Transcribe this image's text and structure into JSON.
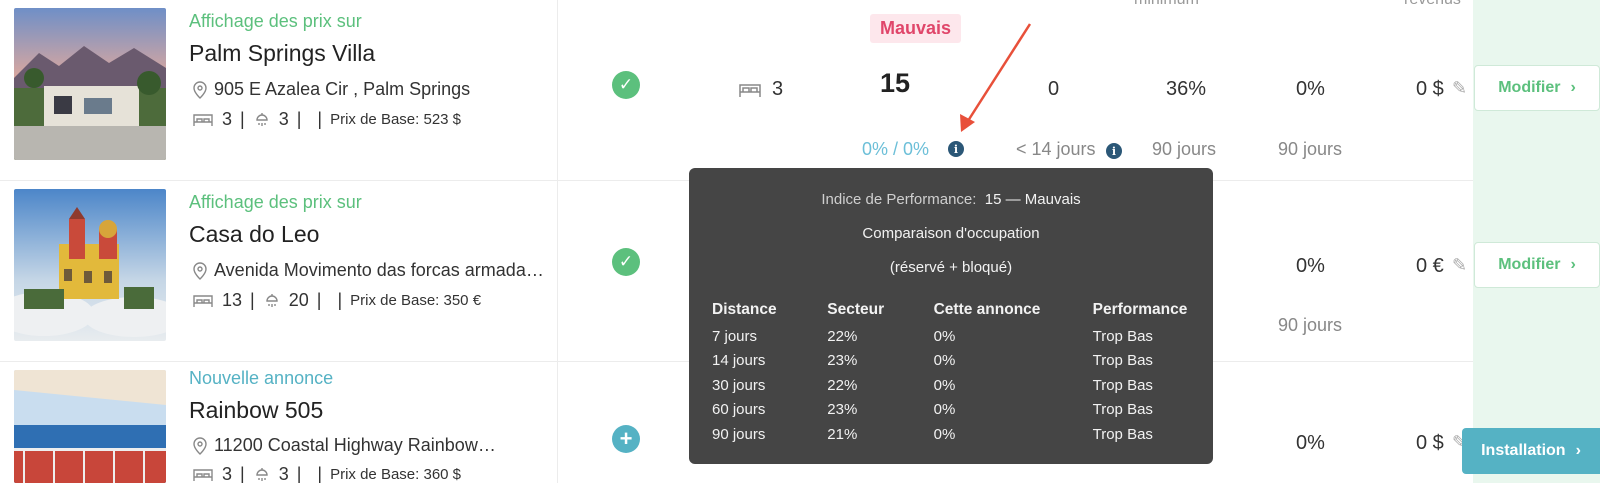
{
  "columns": {
    "minimum_label": "minimum",
    "revenus_label": "revenus"
  },
  "rows": [
    {
      "status": "Affichage des prix sur",
      "name": "Palm Springs Villa",
      "address": "905 E Azalea Cir , Palm Springs",
      "bedrooms": "3",
      "bathrooms": "3",
      "base_price": "Prix de Base: 523 $",
      "beds": "3",
      "perf_badge": "Mauvais",
      "perf_score": "15",
      "occupancy": "0% / 0%",
      "pickup": "0",
      "pickup_sub": "< 14 jours",
      "min_stay": "36%",
      "min_sub": "90 jours",
      "revenue_pct": "0%",
      "rev_sub": "90 jours",
      "revenue": "0 $",
      "modify": "Modifier"
    },
    {
      "status": "Affichage des prix sur",
      "name": "Casa do Leo",
      "address": "Avenida Movimento das forcas armada…",
      "bedrooms": "13",
      "bathrooms": "20",
      "base_price": "Prix de Base: 350 €",
      "revenue_pct": "0%",
      "rev_sub": "90 jours",
      "min_sub_partial": "s",
      "revenue": "0 €",
      "modify": "Modifier"
    },
    {
      "status": "Nouvelle annonce",
      "name": "Rainbow 505",
      "address": "11200 Coastal Highway Rainbow…",
      "bedrooms": "3",
      "bathrooms": "3",
      "base_price": "Prix de Base: 360 $",
      "revenue_pct": "0%",
      "revenue": "0 $"
    }
  ],
  "tooltip": {
    "perf_label": "Indice de Performance:",
    "perf_value": "15 — Mauvais",
    "title": "Comparaison d'occupation",
    "subtitle": "(réservé + bloqué)",
    "headers": [
      "Distance",
      "Secteur",
      "Cette annonce",
      "Performance"
    ],
    "rows": [
      [
        "7 jours",
        "22%",
        "0%",
        "Trop Bas"
      ],
      [
        "14 jours",
        "23%",
        "0%",
        "Trop Bas"
      ],
      [
        "30 jours",
        "22%",
        "0%",
        "Trop Bas"
      ],
      [
        "60 jours",
        "23%",
        "0%",
        "Trop Bas"
      ],
      [
        "90 jours",
        "21%",
        "0%",
        "Trop Bas"
      ]
    ]
  },
  "install_button": "Installation",
  "colors": {
    "green": "#5cc07d",
    "teal": "#55b2c4",
    "bad_red": "#e0466a",
    "tooltip_bg": "#454545",
    "arrow_red": "#e8503a"
  }
}
